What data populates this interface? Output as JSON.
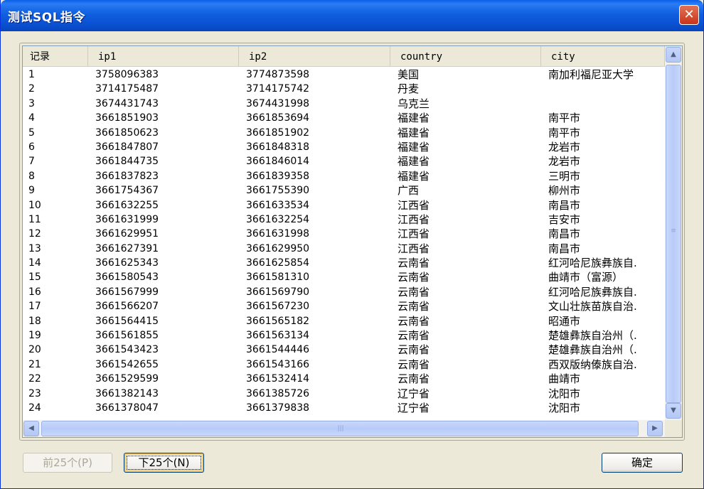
{
  "window": {
    "title": "测试SQL指令",
    "close_icon": "close-icon"
  },
  "table": {
    "columns": [
      "记录",
      "ip1",
      "ip2",
      "country",
      "city"
    ],
    "rows": [
      [
        "1",
        "3758096383",
        "3774873598",
        "美国",
        "南加利福尼亚大学"
      ],
      [
        "2",
        "3714175487",
        "3714175742",
        "丹麦",
        ""
      ],
      [
        "3",
        "3674431743",
        "3674431998",
        "乌克兰",
        ""
      ],
      [
        "4",
        "3661851903",
        "3661853694",
        "福建省",
        "南平市"
      ],
      [
        "5",
        "3661850623",
        "3661851902",
        "福建省",
        "南平市"
      ],
      [
        "6",
        "3661847807",
        "3661848318",
        "福建省",
        "龙岩市"
      ],
      [
        "7",
        "3661844735",
        "3661846014",
        "福建省",
        "龙岩市"
      ],
      [
        "8",
        "3661837823",
        "3661839358",
        "福建省",
        "三明市"
      ],
      [
        "9",
        "3661754367",
        "3661755390",
        "广西",
        "柳州市"
      ],
      [
        "10",
        "3661632255",
        "3661633534",
        "江西省",
        "南昌市"
      ],
      [
        "11",
        "3661631999",
        "3661632254",
        "江西省",
        "吉安市"
      ],
      [
        "12",
        "3661629951",
        "3661631998",
        "江西省",
        "南昌市"
      ],
      [
        "13",
        "3661627391",
        "3661629950",
        "江西省",
        "南昌市"
      ],
      [
        "14",
        "3661625343",
        "3661625854",
        "云南省",
        "红河哈尼族彝族自."
      ],
      [
        "15",
        "3661580543",
        "3661581310",
        "云南省",
        "曲靖市（富源）"
      ],
      [
        "16",
        "3661567999",
        "3661569790",
        "云南省",
        "红河哈尼族彝族自."
      ],
      [
        "17",
        "3661566207",
        "3661567230",
        "云南省",
        "文山壮族苗族自治."
      ],
      [
        "18",
        "3661564415",
        "3661565182",
        "云南省",
        "昭通市"
      ],
      [
        "19",
        "3661561855",
        "3661563134",
        "云南省",
        "楚雄彝族自治州（."
      ],
      [
        "20",
        "3661543423",
        "3661544446",
        "云南省",
        "楚雄彝族自治州（."
      ],
      [
        "21",
        "3661542655",
        "3661543166",
        "云南省",
        "西双版纳傣族自治."
      ],
      [
        "22",
        "3661529599",
        "3661532414",
        "云南省",
        "曲靖市"
      ],
      [
        "23",
        "3661382143",
        "3661385726",
        "辽宁省",
        "沈阳市"
      ],
      [
        "24",
        "3661378047",
        "3661379838",
        "辽宁省",
        "沈阳市"
      ]
    ]
  },
  "scroll": {
    "up_icon": "▲",
    "down_icon": "▼",
    "left_icon": "◀",
    "right_icon": "▶"
  },
  "buttons": {
    "prev_label": "前25个(P)",
    "next_label": "下25个(N)",
    "ok_label": "确定"
  }
}
